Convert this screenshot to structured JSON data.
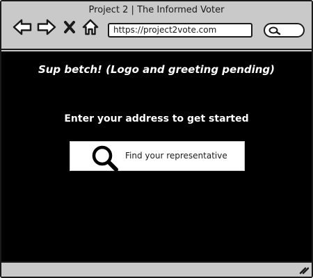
{
  "window": {
    "title": "Project 2 | The Informed Voter"
  },
  "toolbar": {
    "back_icon": "arrow-left-icon",
    "forward_icon": "arrow-right-icon",
    "stop_icon": "close-icon",
    "home_icon": "home-icon",
    "url": "https://project2vote.com",
    "search_icon": "search-icon"
  },
  "page": {
    "greeting": "Sup betch! (Logo and greeting pending)",
    "prompt": "Enter your address to get started",
    "find_button": {
      "icon": "magnifier-icon",
      "label": "Find your representative"
    }
  },
  "colors": {
    "chrome": "#c9c9c9",
    "content_background": "#000000",
    "text_on_dark": "#ffffff",
    "outline": "#1a1a1a"
  }
}
